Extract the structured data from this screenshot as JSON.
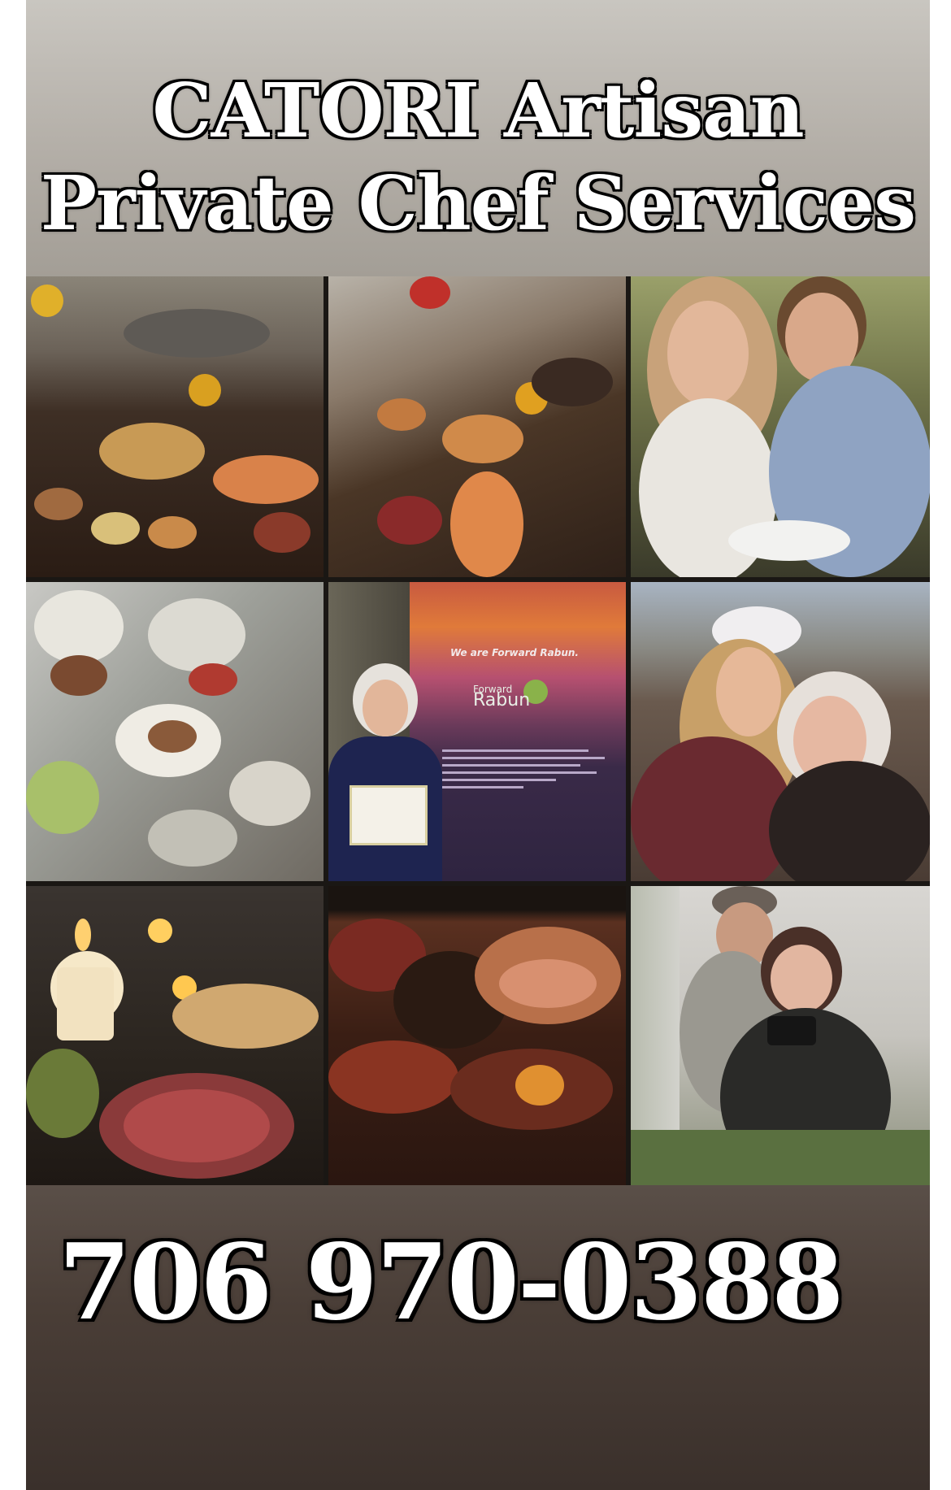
{
  "header": {
    "title_line1": "CATORI Artisan",
    "title_line2": "Private Chef Services"
  },
  "photos": [
    {
      "name": "buffet-table-sunflowers-photo"
    },
    {
      "name": "buffet-spread-angle-photo"
    },
    {
      "name": "couple-smiling-photo"
    },
    {
      "name": "salad-platters-photo"
    },
    {
      "name": "award-recipient-photo",
      "sign_heading": "We are Forward Rabun.",
      "logo_line1": "Forward",
      "logo_line2": "Rabun"
    },
    {
      "name": "two-women-mountain-photo"
    },
    {
      "name": "candlelit-charcuterie-photo"
    },
    {
      "name": "grilled-meats-photo"
    },
    {
      "name": "chefs-holding-camera-photo"
    }
  ],
  "footer": {
    "phone": "706 970-0388"
  }
}
